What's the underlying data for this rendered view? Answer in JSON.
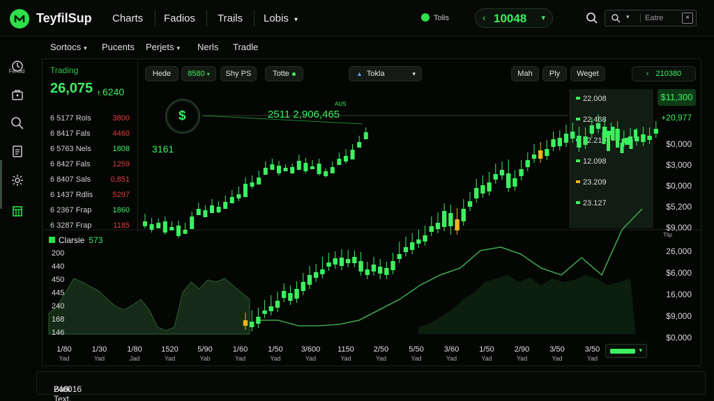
{
  "app": {
    "brand": "TeyfilSup",
    "nav": [
      "Charts",
      "Fadios",
      "Trails",
      "Lobis"
    ],
    "live_label": "Tolis",
    "balance": "10048",
    "search_placeholder": "Eatre"
  },
  "subnav": [
    "Sortocs",
    "Pucents",
    "Perjets",
    "Nerls",
    "Tradle"
  ],
  "sidebar": {
    "label": "Feroid"
  },
  "left_panel": {
    "title": "Trading",
    "big_value": "26,075",
    "big_value_2": "6240",
    "rows": [
      {
        "name": "6 5177 Rols",
        "value": "3800",
        "color": "#e23b3b"
      },
      {
        "name": "6 8417 Fals",
        "value": "4460",
        "color": "#e23b3b"
      },
      {
        "name": "6 5763 Nels",
        "value": "1808",
        "color": "#3cf060"
      },
      {
        "name": "6 8427 Fals",
        "value": "1259",
        "color": "#e23b3b"
      },
      {
        "name": "6 8407 Sals",
        "value": "0,851",
        "color": "#e23b3b"
      },
      {
        "name": "6 1437 Rdlis",
        "value": "5297",
        "color": "#e23b3b"
      },
      {
        "name": "6 2367 Frap",
        "value": "1860",
        "color": "#3cf060"
      },
      {
        "name": "6 3287 Frap",
        "value": "1185",
        "color": "#e23b3b"
      }
    ]
  },
  "toolbar": {
    "pills": [
      "Hede",
      "8580",
      "Shy PS",
      "Totte"
    ],
    "dropdown": "Tokla",
    "right_pills": [
      "Mah",
      "Ply",
      "Weget"
    ],
    "right_value": "210380"
  },
  "chart_overlay": {
    "badge_value": "3161",
    "annotation": "2511 2,906,465",
    "annotation_small": "AUS"
  },
  "order_book": [
    {
      "value": "22.008",
      "color": "#3cf060"
    },
    {
      "value": "22.468",
      "color": "#3cf060"
    },
    {
      "value": "52.210",
      "color": "#3cf060"
    },
    {
      "value": "12.098",
      "color": "#3cf060"
    },
    {
      "value": "23.209",
      "color": "#f0b21a"
    },
    {
      "value": "23.127",
      "color": "#3cf060"
    }
  ],
  "right_axis_top": {
    "highlight": "$11,300",
    "up_value": "+20,977",
    "ticks": [
      "$0,000",
      "$3,000",
      "$0,000",
      "$5,200",
      "$9,000"
    ],
    "small_label": "Tlip"
  },
  "right_axis_bottom": [
    "26,000",
    "$6,000",
    "16,000",
    "$9,000",
    "$0,000"
  ],
  "lower_chart": {
    "legend_label": "Clarsie",
    "legend_value": "573",
    "y_ticks": [
      "200",
      "440",
      "450",
      "445",
      "240",
      "168",
      "146"
    ],
    "x_ticks": [
      {
        "v": "1/80",
        "s": "Yad"
      },
      {
        "v": "1/30",
        "s": "Yad"
      },
      {
        "v": "1/80",
        "s": "Jad"
      },
      {
        "v": "1520",
        "s": "Yad"
      },
      {
        "v": "5/90",
        "s": "Yab"
      },
      {
        "v": "1/60",
        "s": "Yad"
      },
      {
        "v": "1/50",
        "s": "Yad"
      },
      {
        "v": "3/600",
        "s": "Yad"
      },
      {
        "v": "1150",
        "s": "Yad"
      },
      {
        "v": "2/50",
        "s": "Yad"
      },
      {
        "v": "5/50",
        "s": "Yad"
      },
      {
        "v": "3/60",
        "s": "Yad"
      },
      {
        "v": "1/50",
        "s": "Yad"
      },
      {
        "v": "2/90",
        "s": "Yad"
      },
      {
        "v": "3/50",
        "s": "Yad"
      },
      {
        "v": "3/50",
        "s": "Yad"
      }
    ]
  },
  "status": {
    "text": "Bark Text.",
    "value": "246016"
  },
  "colors": {
    "accent": "#3cf060",
    "down": "#e23b3b",
    "warn": "#f0b21a",
    "bg": "#050705"
  },
  "chart_data": {
    "type": "candlestick",
    "series": [
      {
        "name": "candles",
        "values": [
          [
            318,
            325,
            309,
            322
          ],
          [
            322,
            330,
            315,
            328
          ],
          [
            328,
            320,
            316,
            318
          ],
          [
            318,
            334,
            313,
            331
          ],
          [
            331,
            326,
            320,
            324
          ],
          [
            324,
            339,
            319,
            336
          ],
          [
            336,
            330,
            322,
            329
          ],
          [
            329,
            311,
            306,
            309
          ],
          [
            309,
            300,
            293,
            302
          ],
          [
            302,
            312,
            297,
            306
          ],
          [
            306,
            295,
            288,
            297
          ],
          [
            297,
            305,
            291,
            300
          ],
          [
            300,
            290,
            283,
            292
          ],
          [
            292,
            283,
            275,
            279
          ],
          [
            279,
            285,
            270,
            283
          ],
          [
            283,
            264,
            257,
            262
          ],
          [
            262,
            268,
            254,
            265
          ],
          [
            265,
            255,
            247,
            251
          ],
          [
            251,
            241,
            234,
            244
          ],
          [
            244,
            236,
            230,
            238
          ],
          [
            238,
            249,
            233,
            246
          ],
          [
            246,
            241,
            238,
            240
          ],
          [
            240,
            249,
            237,
            244
          ],
          [
            244,
            231,
            224,
            234
          ],
          [
            234,
            246,
            229,
            243
          ],
          [
            243,
            239,
            232,
            235
          ],
          [
            235,
            250,
            230,
            246
          ],
          [
            246,
            253,
            244,
            249
          ],
          [
            249,
            240,
            234,
            237
          ],
          [
            237,
            228,
            221,
            224
          ],
          [
            224,
            232,
            216,
            229
          ],
          [
            229,
            215,
            209,
            212
          ],
          [
            212,
            204,
            197,
            200
          ],
          [
            200,
            190,
            185,
            193
          ]
        ]
      },
      {
        "name": "candles_main",
        "values": [
          [
            468,
            460,
            455,
            462
          ],
          [
            462,
            470,
            452,
            465
          ],
          [
            465,
            455,
            448,
            451
          ],
          [
            451,
            446,
            437,
            440
          ],
          [
            440,
            447,
            430,
            442
          ],
          [
            442,
            432,
            425,
            428
          ],
          [
            428,
            418,
            413,
            421
          ],
          [
            421,
            432,
            416,
            429
          ],
          [
            429,
            415,
            410,
            418
          ],
          [
            418,
            405,
            398,
            409
          ],
          [
            409,
            395,
            388,
            399
          ],
          [
            399,
            391,
            385,
            394
          ],
          [
            394,
            387,
            375,
            377
          ],
          [
            377,
            383,
            369,
            380
          ],
          [
            380,
            371,
            367,
            370
          ],
          [
            370,
            382,
            364,
            378
          ],
          [
            378,
            372,
            365,
            369
          ],
          [
            369,
            378,
            366,
            375
          ],
          [
            375,
            390,
            368,
            387
          ],
          [
            387,
            395,
            382,
            390
          ],
          [
            390,
            380,
            375,
            383
          ],
          [
            383,
            393,
            378,
            395
          ],
          [
            395,
            385,
            382,
            388
          ],
          [
            388,
            375,
            369,
            372
          ],
          [
            372,
            365,
            353,
            355
          ],
          [
            355,
            362,
            346,
            359
          ],
          [
            359,
            348,
            341,
            344
          ],
          [
            344,
            350,
            336,
            347
          ],
          [
            347,
            338,
            330,
            333
          ],
          [
            333,
            325,
            317,
            320
          ],
          [
            320,
            329,
            311,
            326
          ],
          [
            326,
            303,
            298,
            306
          ],
          [
            306,
            325,
            300,
            331
          ],
          [
            331,
            315,
            305,
            318
          ],
          [
            318,
            300,
            292,
            297
          ],
          [
            297,
            289,
            282,
            285
          ],
          [
            285,
            270,
            263,
            266
          ],
          [
            266,
            278,
            258,
            275
          ],
          [
            275,
            262,
            253,
            258
          ],
          [
            258,
            250,
            241,
            244
          ],
          [
            244,
            252,
            238,
            249
          ],
          [
            249,
            270,
            235,
            268
          ],
          [
            268,
            256,
            250,
            253
          ],
          [
            253,
            243,
            236,
            240
          ],
          [
            240,
            230,
            225,
            228
          ],
          [
            228,
            222,
            213,
            216
          ],
          [
            216,
            228,
            210,
            224
          ],
          [
            224,
            214,
            207,
            211
          ],
          [
            211,
            200,
            195,
            198
          ],
          [
            198,
            210,
            193,
            205
          ],
          [
            205,
            192,
            185,
            189
          ],
          [
            189,
            199,
            182,
            195
          ],
          [
            195,
            212,
            188,
            208
          ],
          [
            208,
            196,
            189,
            192
          ],
          [
            192,
            180,
            175,
            177
          ],
          [
            177,
            185,
            170,
            182
          ],
          [
            182,
            198,
            176,
            194
          ],
          [
            194,
            188,
            182,
            185
          ],
          [
            185,
            202,
            180,
            199
          ],
          [
            199,
            205,
            193,
            196
          ],
          [
            196,
            208,
            190,
            203
          ],
          [
            203,
            196,
            190,
            193
          ],
          [
            193,
            204,
            188,
            201
          ],
          [
            201,
            195,
            189,
            192
          ],
          [
            192,
            185,
            180,
            183
          ]
        ]
      }
    ],
    "overlay_line": [
      {
        "name": "trend",
        "values": [
          470,
          470,
          478,
          478,
          476,
          470,
          455,
          440,
          420,
          405,
          395,
          370,
          365,
          375,
          395,
          405,
          380,
          405,
          340,
          310
        ]
      }
    ],
    "area": {
      "name": "volume",
      "values": [
        450,
        440,
        420,
        400,
        405,
        412,
        418,
        430,
        440,
        445,
        438,
        430,
        445,
        470,
        475,
        470,
        420,
        405,
        415,
        402,
        405,
        400,
        410,
        420,
        430
      ]
    }
  }
}
